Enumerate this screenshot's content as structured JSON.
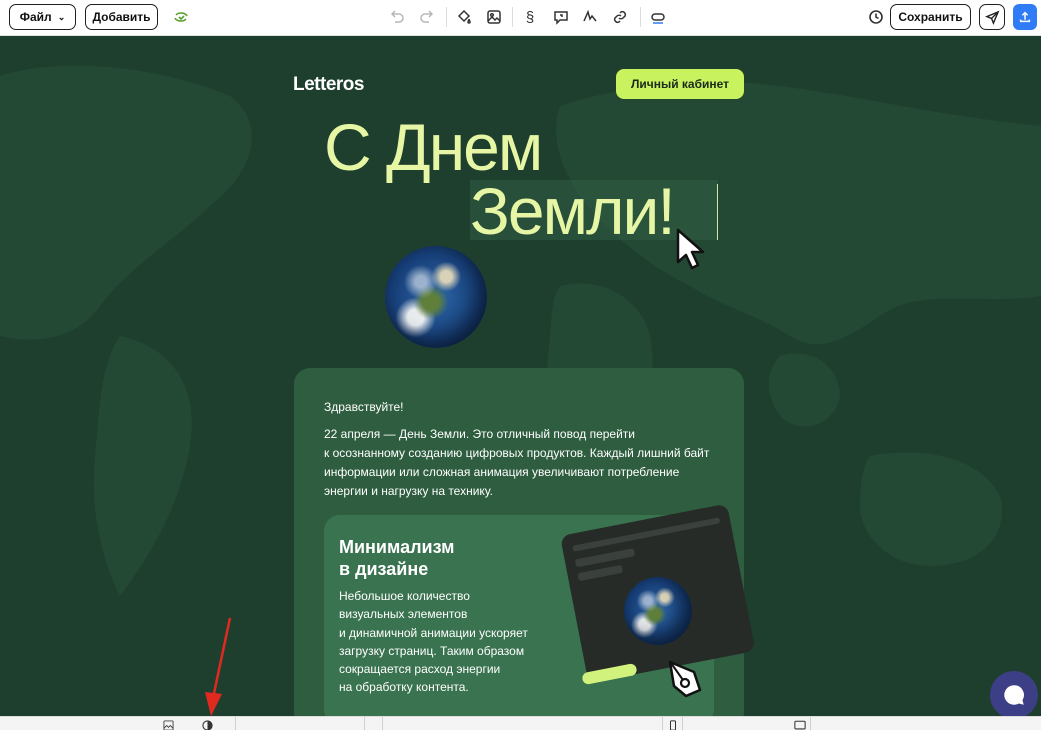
{
  "toolbar": {
    "file_label": "Файл",
    "add_label": "Добавить",
    "save_label": "Сохранить"
  },
  "email": {
    "logo": "Letteros",
    "cabinet_button": "Личный кабинет",
    "headline_line1": "С Днем",
    "headline_line2": "Земли!",
    "greeting": "Здравствуйте!",
    "paragraph_lines": [
      "22 апреля — День Земли. Это отличный повод перейти",
      "к осознанному созданию цифровых продуктов. Каждый лишний байт",
      "информации или сложная анимация увеличивают потребление",
      "энергии и нагрузку на технику."
    ],
    "block_title_lines": [
      "Минимализм",
      "в дизайне"
    ],
    "block_text_lines": [
      "Небольшое количество",
      "визуальных элементов",
      "и динамичной анимации ускоряет",
      "загрузку страниц. Таким образом",
      "сокращается расход энергии",
      "на обработку контента."
    ]
  },
  "colors": {
    "canvas_bg": "#1e3f2d",
    "accent_lime": "#c9f25f",
    "headline": "#e6f6a5",
    "card_bg": "#2e5d40",
    "inner_bg": "#3a7350",
    "publish_blue": "#2f7cf6",
    "chat_bg": "#3d3f86",
    "annotation_red": "#e02a20"
  }
}
